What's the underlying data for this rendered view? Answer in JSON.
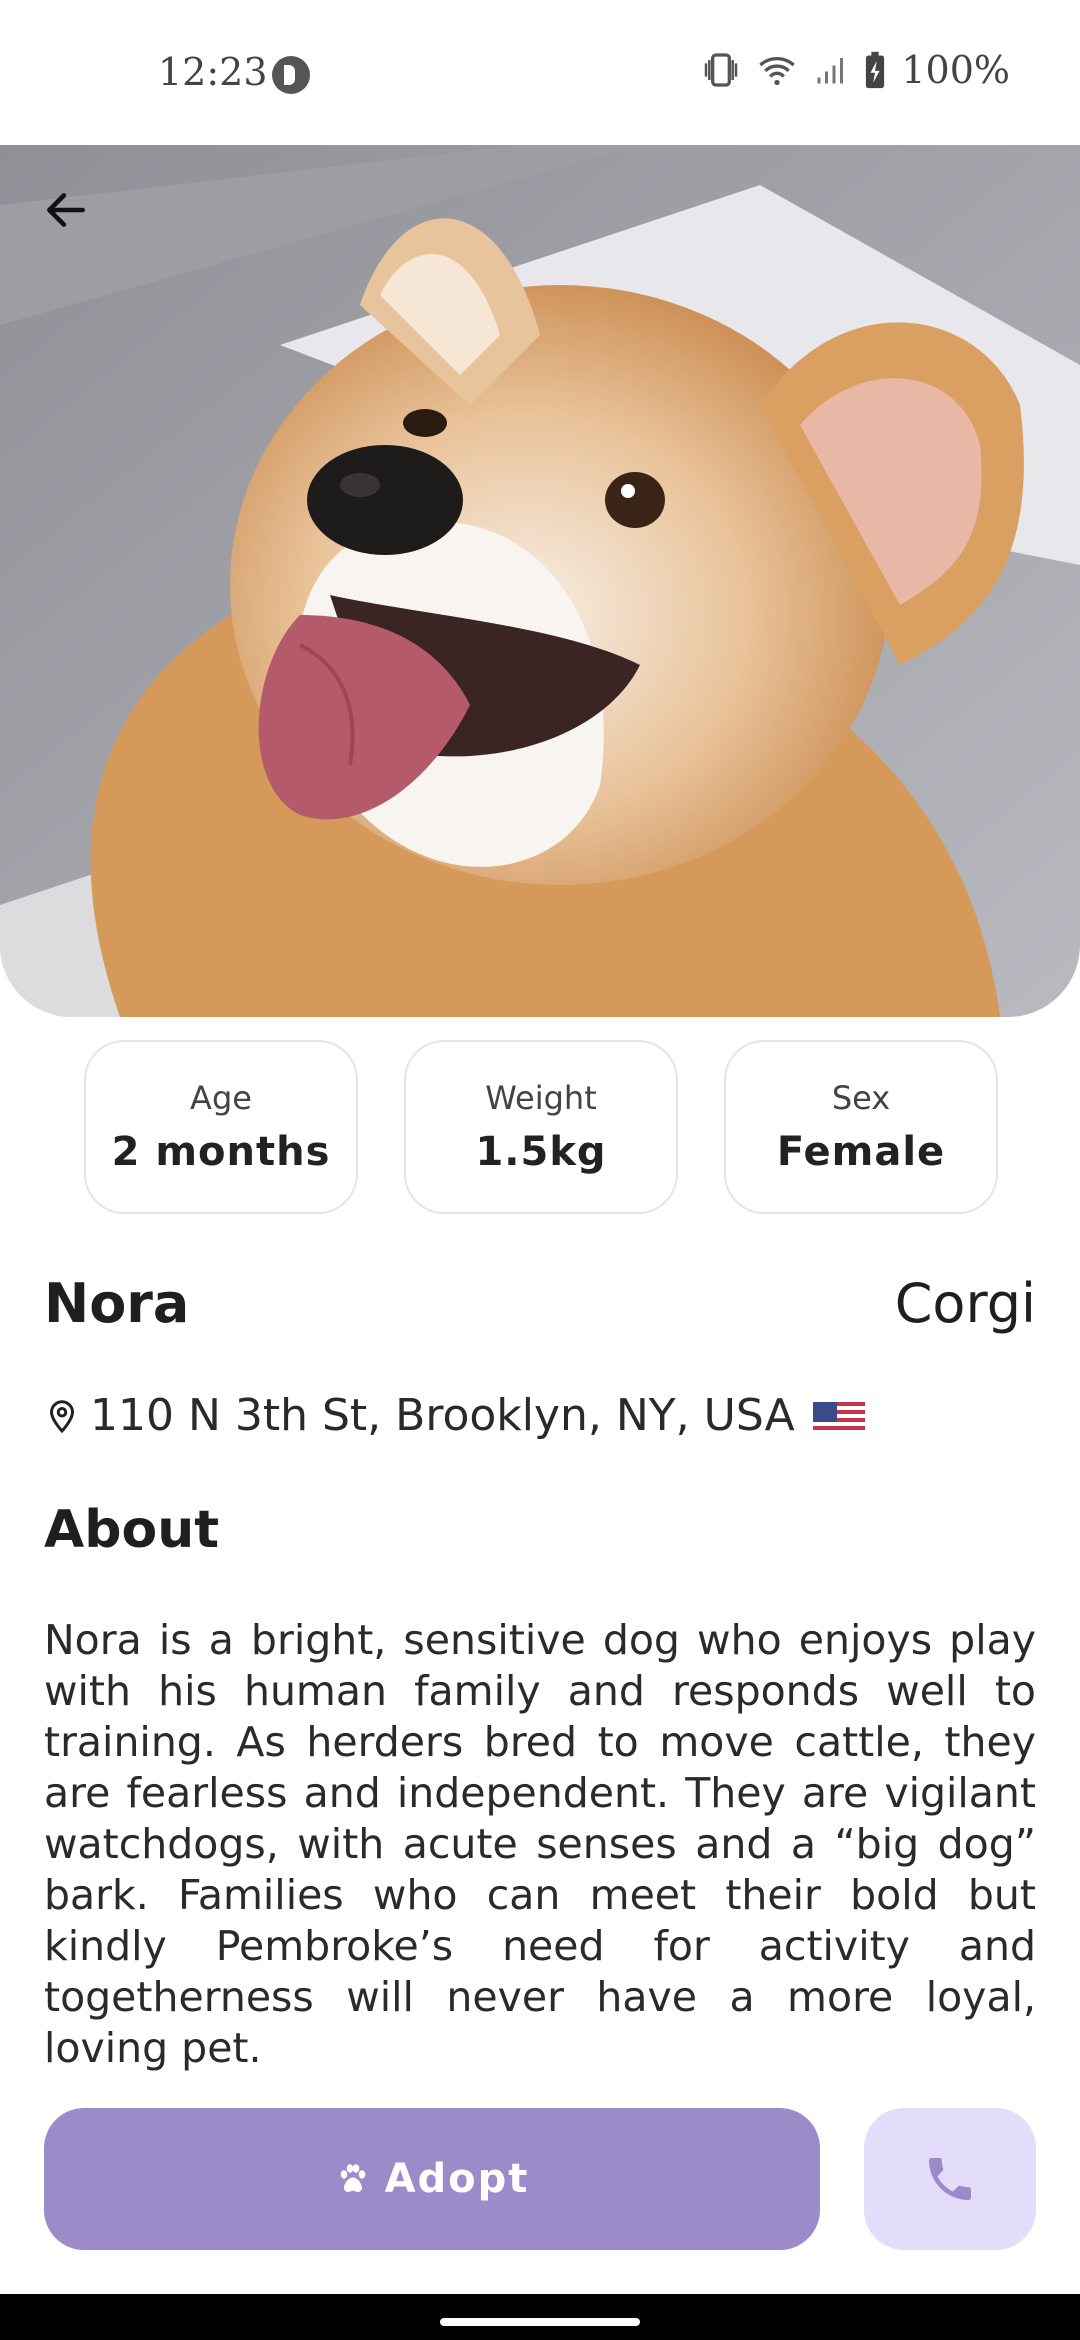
{
  "status_bar": {
    "time": "12:23",
    "battery": "100%",
    "icons": [
      "app-notification-icon",
      "vibrate-icon",
      "wifi-icon",
      "signal-icon",
      "battery-charging-icon"
    ]
  },
  "hero": {
    "image": "corgi-photo",
    "back_icon": "arrow-left-icon"
  },
  "stats": [
    {
      "label": "Age",
      "value": "2 months"
    },
    {
      "label": "Weight",
      "value": "1.5kg"
    },
    {
      "label": "Sex",
      "value": "Female"
    }
  ],
  "pet": {
    "name": "Nora",
    "breed": "Corgi",
    "location": "110 N 3th St, Brooklyn, NY, USA",
    "location_icon": "map-pin-icon",
    "flag_icon": "us-flag-icon"
  },
  "about": {
    "title": "About",
    "text": "Nora is a bright, sensitive dog who enjoys play with his human family and responds well to training. As herders bred to move cattle, they are fearless and independent. They are vigilant watchdogs, with acute senses and a “big dog” bark. Families who can meet their bold but kindly Pembroke’s need for activity and togetherness will never have a more loyal, loving pet."
  },
  "actions": {
    "adopt_label": "Adopt",
    "adopt_icon": "paw-icon",
    "call_icon": "phone-icon"
  },
  "colors": {
    "primary": "#9b8cc9",
    "primary_light": "#e4ddfa",
    "card_border": "#e4e4e4"
  }
}
